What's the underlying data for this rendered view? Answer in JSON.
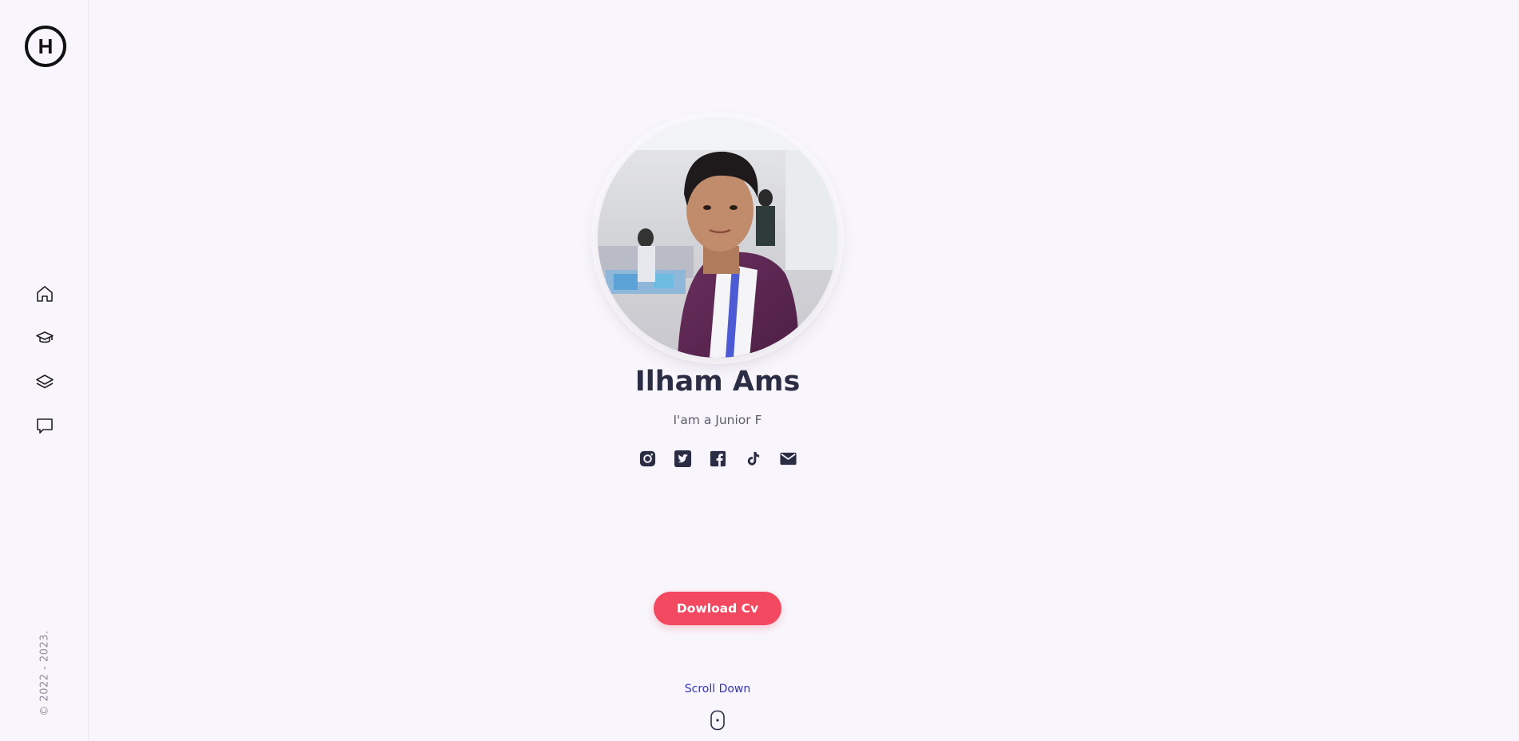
{
  "profile": {
    "name": "Ilham Ams",
    "tagline": "I'am a Junior F"
  },
  "actions": {
    "download_label": "Dowload Cv",
    "scroll_label": "Scroll Down"
  },
  "footer": {
    "copyright": "© 2022 - 2023."
  },
  "logo": {
    "letter": "H"
  },
  "nav": {
    "items": [
      {
        "icon": "home-icon"
      },
      {
        "icon": "graduation-cap-icon"
      },
      {
        "icon": "layers-icon"
      },
      {
        "icon": "message-icon"
      }
    ]
  },
  "socials": [
    {
      "icon": "instagram-icon"
    },
    {
      "icon": "twitter-icon"
    },
    {
      "icon": "facebook-icon"
    },
    {
      "icon": "tiktok-icon"
    },
    {
      "icon": "email-icon"
    }
  ],
  "colors": {
    "background": "#f8f6fc",
    "accent": "#f24860",
    "text_dark": "#2b2d45",
    "link": "#3333bb",
    "progress": "#1f8a5b"
  }
}
